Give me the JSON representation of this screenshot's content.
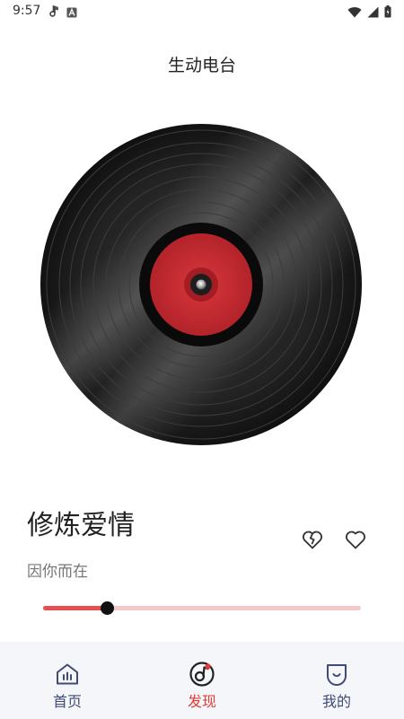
{
  "status_bar": {
    "time": "9:57",
    "left_icons": [
      "music-note-icon",
      "accessibility-a-icon"
    ],
    "right_icons": [
      "wifi-icon",
      "signal-icon",
      "battery-icon"
    ]
  },
  "header": {
    "title": "生动电台"
  },
  "record": {
    "icon": "vinyl-record-icon",
    "label_color": "#c0272d"
  },
  "song": {
    "title": "修炼爱情",
    "artist": "因你而在"
  },
  "actions": {
    "dislike_icon": "broken-heart-icon",
    "like_icon": "heart-icon"
  },
  "progress": {
    "fraction": 0.2,
    "fill_color": "#e54f4f",
    "track_color": "#f5c9c9"
  },
  "bottom_nav": {
    "items": [
      {
        "label": "首页",
        "icon": "home-icon",
        "active": false
      },
      {
        "label": "发现",
        "icon": "music-disc-icon",
        "active": true
      },
      {
        "label": "我的",
        "icon": "profile-icon",
        "active": false
      }
    ],
    "active_color": "#e53935",
    "inactive_color": "#3f4a75"
  }
}
